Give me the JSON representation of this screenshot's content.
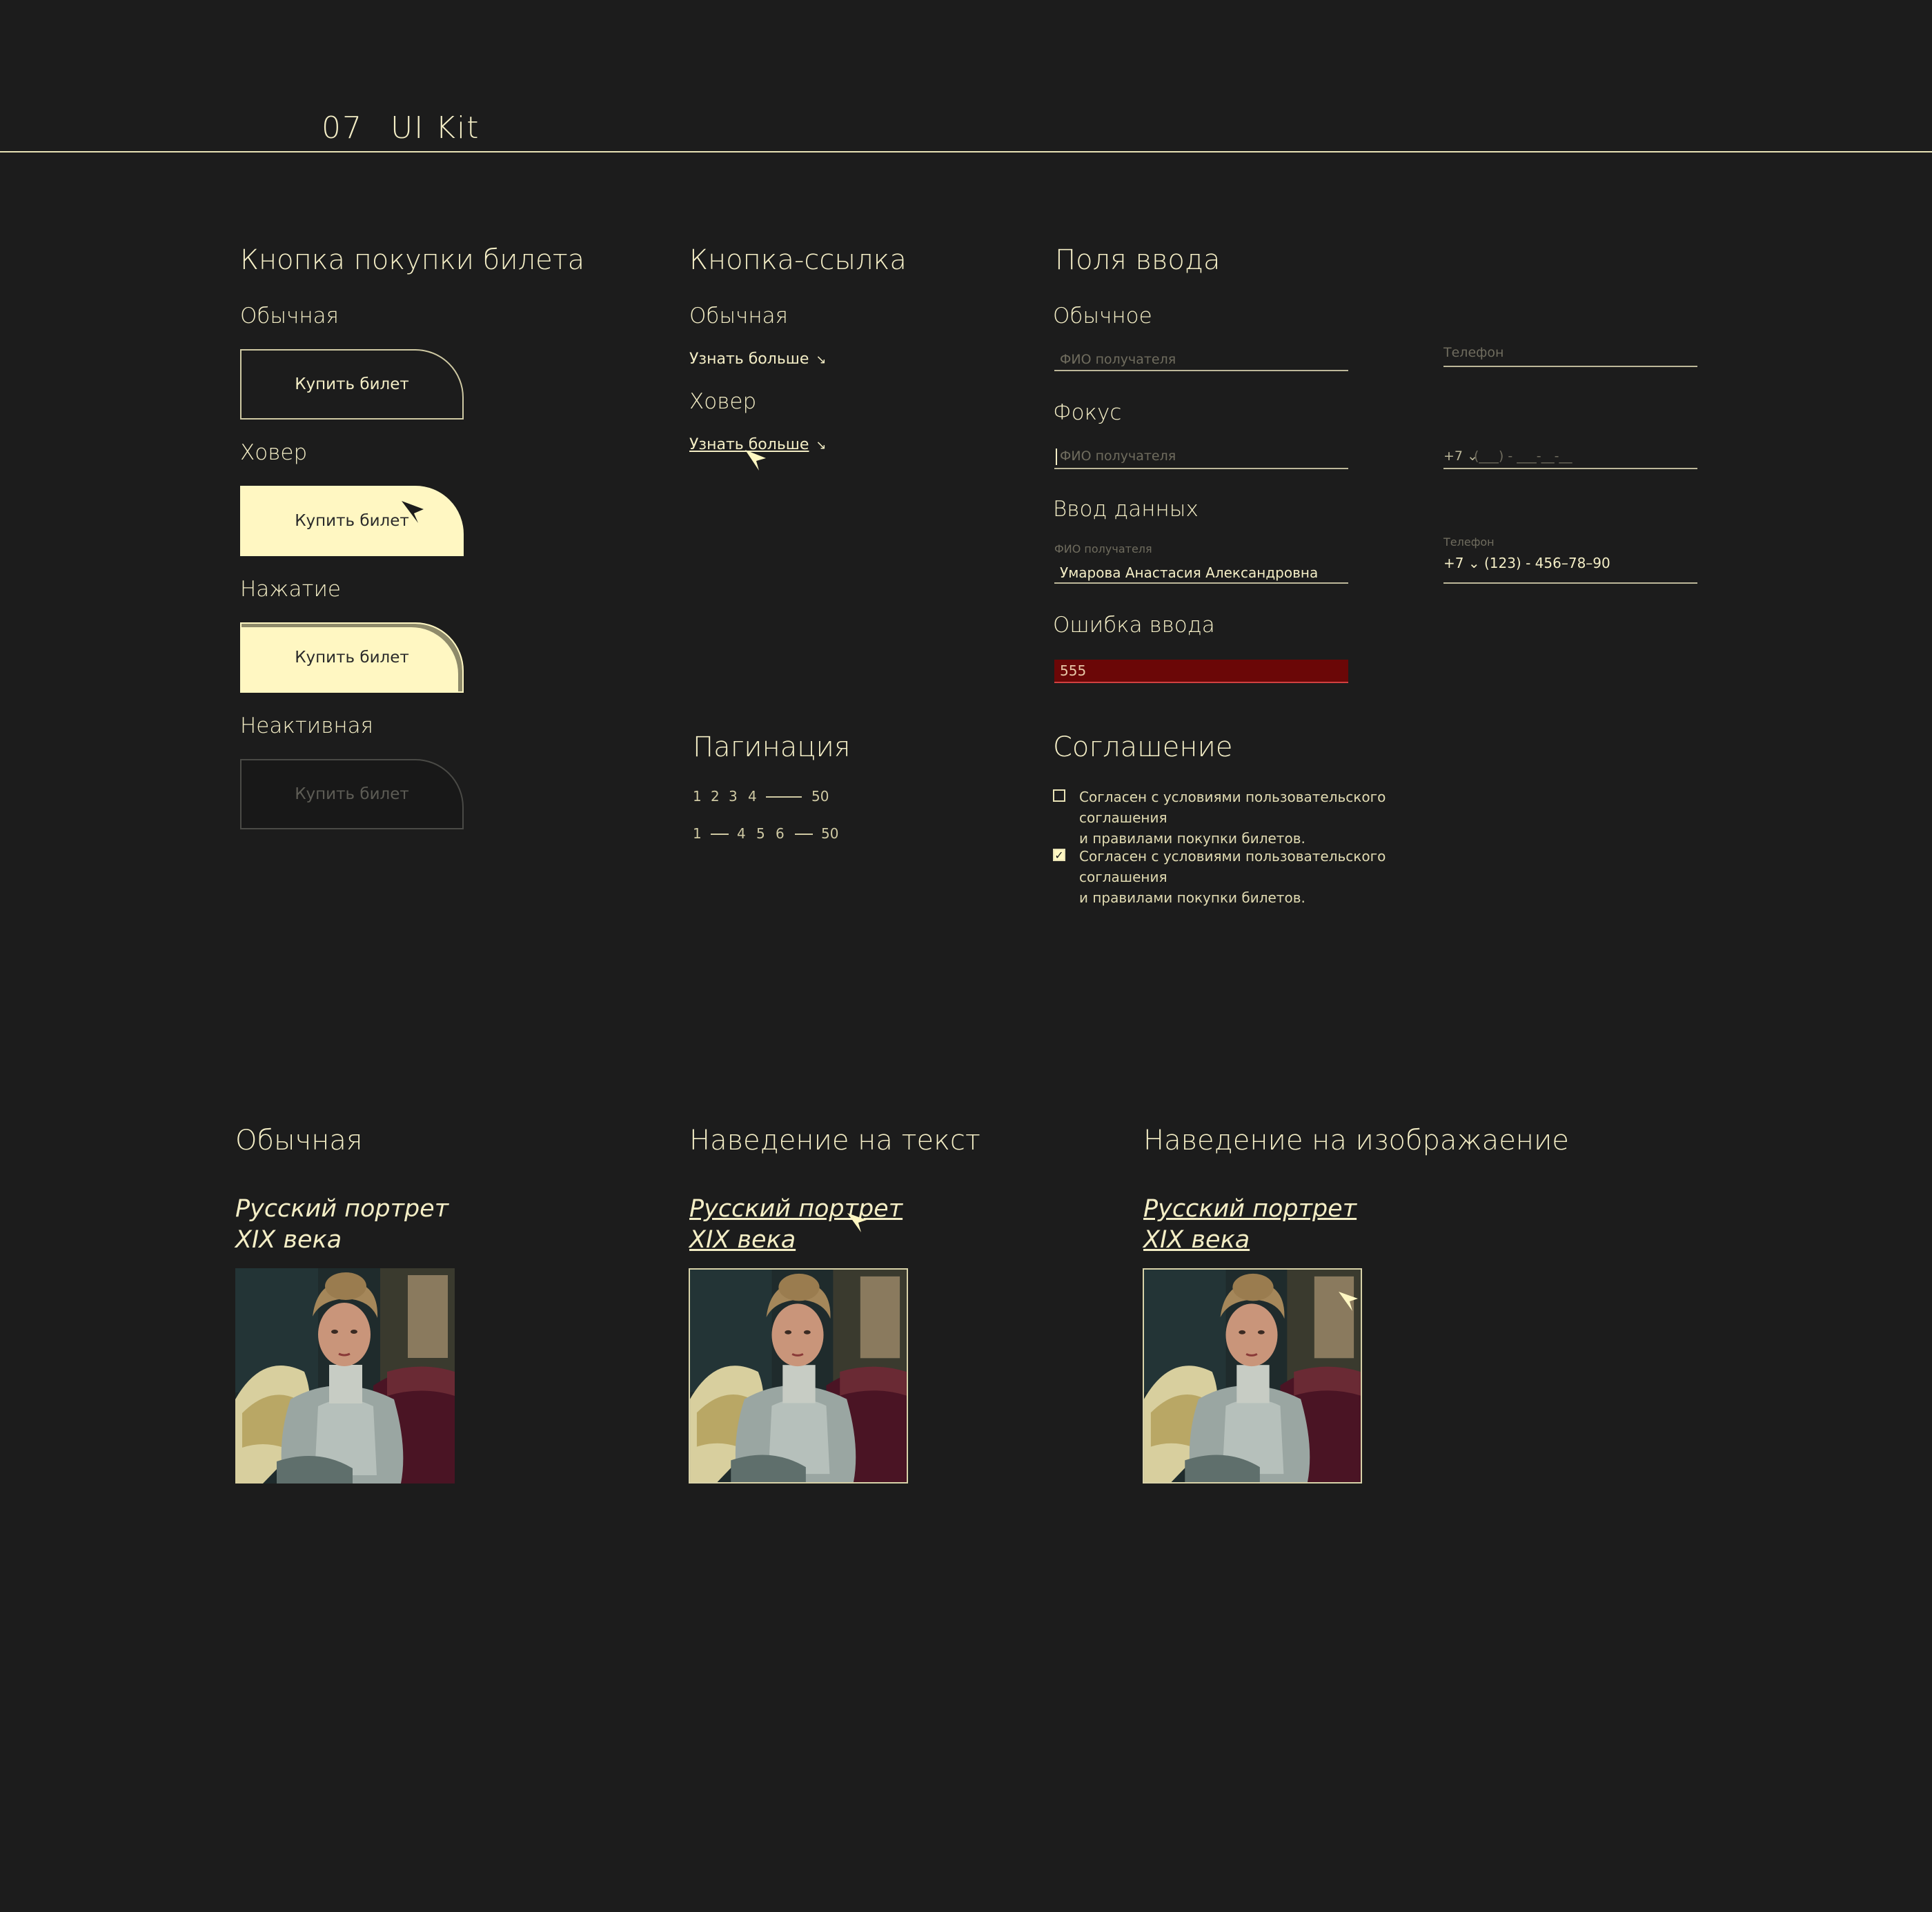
{
  "header": {
    "number": "07",
    "title": "UI Kit"
  },
  "ticket_button": {
    "title": "Кнопка покупки билета",
    "states": [
      {
        "label": "Обычная",
        "text": "Купить билет"
      },
      {
        "label": "Ховер",
        "text": "Купить билет"
      },
      {
        "label": "Нажатие",
        "text": "Купить билет"
      },
      {
        "label": "Неактивная",
        "text": "Купить билет"
      }
    ]
  },
  "link_button": {
    "title": "Кнопка-ссылка",
    "states": [
      {
        "label": "Обычная",
        "text": "Узнать больше"
      },
      {
        "label": "Ховер",
        "text": "Узнать больше"
      }
    ],
    "arrow_icon": "arrow-down-right-icon"
  },
  "inputs": {
    "title": "Поля ввода",
    "normal": {
      "label": "Обычное",
      "name_placeholder": "ФИО получателя",
      "phone_placeholder": "Телефон"
    },
    "focus": {
      "label": "Фокус",
      "name_placeholder": "ФИО получателя",
      "phone_prefix": "+7",
      "phone_mask": "(___) - ___-__-__"
    },
    "filled": {
      "label": "Ввод данных",
      "name_label": "ФИО получателя",
      "name_value": "Умарова Анастасия Александровна",
      "phone_label": "Телефон",
      "phone_value": "+7 ⌄ (123) - 456–78–90"
    },
    "error": {
      "label": "Ошибка ввода",
      "value": "555"
    }
  },
  "pagination": {
    "title": "Пагинация",
    "row1": [
      "1",
      "2",
      "3",
      "4",
      "50"
    ],
    "row2": [
      "1",
      "4",
      "5",
      "6",
      "50"
    ]
  },
  "agreement": {
    "title": "Соглашение",
    "items": [
      {
        "checked": false,
        "line1": "Согласен с условиями пользовательского соглашения",
        "line2": "и правилами покупки билетов."
      },
      {
        "checked": true,
        "line1": "Согласен с условиями пользовательского соглашения",
        "line2": "и правилами покупки билетов."
      }
    ]
  },
  "cards": [
    {
      "state": "Обычная",
      "title_line1": "Русский портрет",
      "title_line2": "XIX века"
    },
    {
      "state": "Наведение на текст",
      "title_line1": "Русский портрет",
      "title_line2": "XIX века"
    },
    {
      "state": "Наведение на изображаение",
      "title_line1": "Русский портрет",
      "title_line2": "XIX века"
    }
  ],
  "colors": {
    "background": "#1c1c1c",
    "accent": "#fff7c2",
    "text": "#f4eec6",
    "error": "#6b0707"
  }
}
